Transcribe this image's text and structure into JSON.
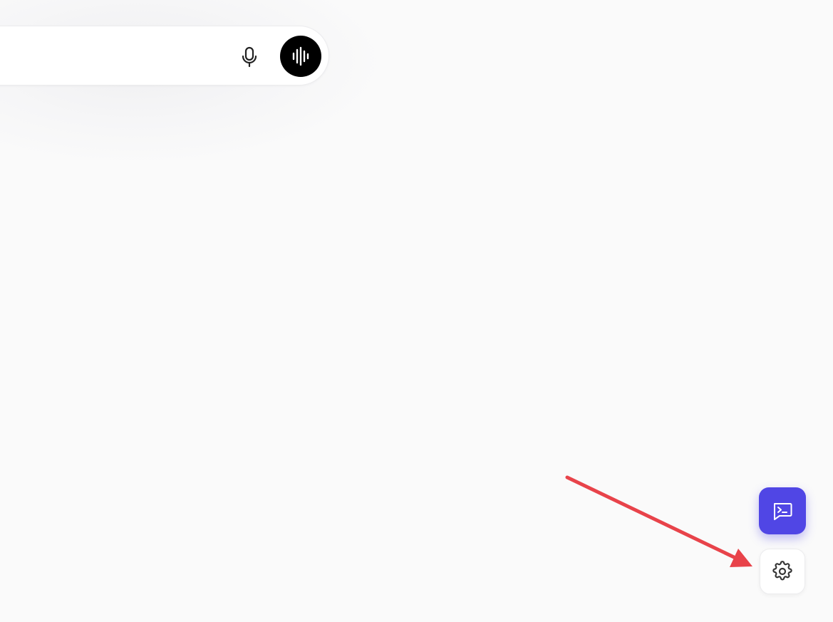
{
  "composer": {
    "input_value": "",
    "input_placeholder": "",
    "mic_icon": "microphone-icon",
    "voice_icon": "audio-waveform-icon",
    "voice_button_color": "#000000"
  },
  "floating_actions": {
    "console_icon": "terminal-message-icon",
    "console_color": "#5046e5",
    "settings_icon": "gear-icon"
  },
  "annotation": {
    "arrow_color": "#e8434a",
    "points_to": "settings-button"
  }
}
